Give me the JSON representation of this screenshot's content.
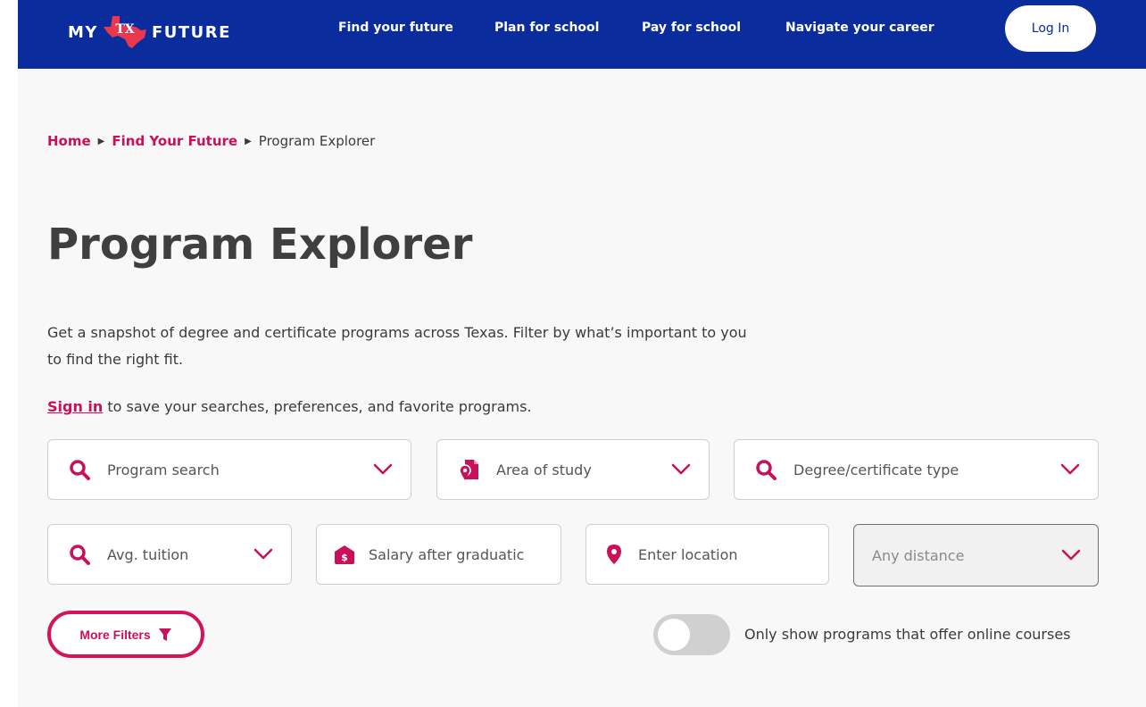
{
  "nav": {
    "logo_left": "MY",
    "logo_middle": "TX",
    "logo_right": "FUTURE",
    "links": [
      "Find your future",
      "Plan for school",
      "Pay for school",
      "Navigate your career"
    ],
    "login_label": "Log In"
  },
  "breadcrumb": {
    "items": [
      "Home",
      "Find Your Future"
    ],
    "current": "Program Explorer"
  },
  "page_title": "Program Explorer",
  "intro": "Get a snapshot of degree and certificate programs across Texas. Filter by what’s important to you to find the right fit.",
  "signin": {
    "link": "Sign in",
    "text": " to save your searches, preferences, and favorite programs."
  },
  "filters": {
    "program_search": "Program search",
    "area_of_study": "Area of study",
    "degree_type": "Degree/certificate type",
    "avg_tuition": "Avg. tuition",
    "salary": "Salary after graduatic",
    "location_placeholder": "Enter location",
    "distance": "Any distance"
  },
  "more_filters_label": "More Filters",
  "online_toggle": {
    "label": "Only show programs that offer online courses",
    "on": false
  },
  "colors": {
    "nav_bg": "#0b2c9c",
    "accent": "#c8115a",
    "page_bg": "#f8f8f8",
    "logo_red": "#e8384f"
  },
  "icons": {
    "search": "search-icon",
    "area": "area-of-study-icon",
    "salary": "money-icon",
    "location": "location-pin-icon",
    "chevron": "chevron-down-icon",
    "funnel": "funnel-icon"
  }
}
